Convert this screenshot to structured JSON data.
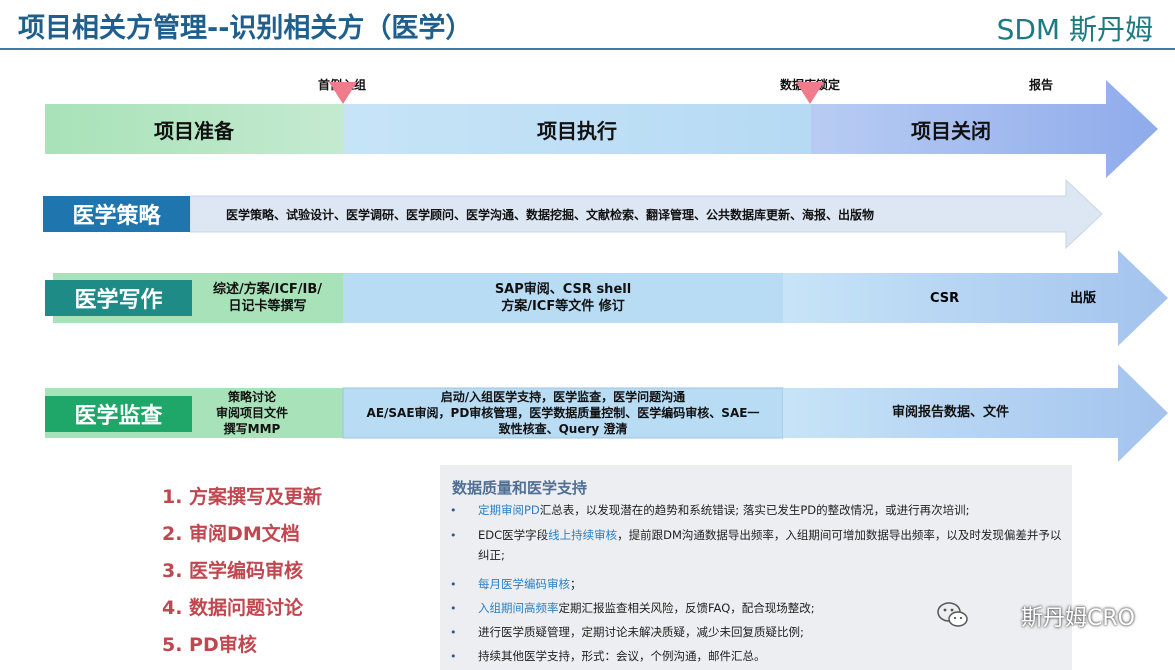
{
  "header": {
    "title": "项目相关方管理--识别相关方（医学）",
    "brand": "SDM 斯丹姆"
  },
  "milestones": {
    "first_enroll": "首例入组",
    "db_lock": "数据库锁定",
    "report": "报告"
  },
  "phases": {
    "prepare": "项目准备",
    "execute": "项目执行",
    "close": "项目关闭"
  },
  "strategy": {
    "label": "医学策略",
    "text": "医学策略、试验设计、医学调研、医学顾问、医学沟通、数据挖掘、文献检索、翻译管理、公共数据库更新、海报、出版物"
  },
  "writing": {
    "label": "医学写作",
    "prep_line1": "综述/方案/ICF/IB/",
    "prep_line2": "日记卡等撰写",
    "exec_line1": "SAP审阅、CSR shell",
    "exec_line2": "方案/ICF等文件 修订",
    "csr": "CSR",
    "publish": "出版"
  },
  "monitoring": {
    "label": "医学监查",
    "prep_line1": "策略讨论",
    "prep_line2": "审阅项目文件",
    "prep_line3": "撰写MMP",
    "exec_line1": "启动/入组医学支持，医学监查，医学问题沟通",
    "exec_line2": "AE/SAE审阅，PD审核管理，医学数据质量控制、医学编码审核、SAE一",
    "exec_line3": "致性核查、Query 澄清",
    "close_text": "审阅报告数据、文件"
  },
  "numbered_list": [
    "1. 方案撰写及更新",
    "2. 审阅DM文档",
    "3. 医学编码审核",
    "4. 数据问题讨论",
    "5. PD审核"
  ],
  "panel": {
    "title": "数据质量和医学支持",
    "b1_hl": "定期审阅PD",
    "b1_rest": "汇总表，以发现潜在的趋势和系统错误; 落实已发生PD的整改情况，或进行再次培训;",
    "b2_pre": "EDC医学字段",
    "b2_hl": "线上持续审核",
    "b2_rest": "，提前跟DM沟通数据导出频率，入组期间可增加数据导出频率，以及时发现偏差并予以纠正;",
    "b3_hl": "每月医学编码审核",
    "b3_rest": "；",
    "b4_hl": "入组期间高频率",
    "b4_rest": "定期汇报监查相关风险，反馈FAQ，配合现场整改;",
    "b5": "进行医学质疑管理，定期讨论未解决质疑，减少未回复质疑比例;",
    "b6": "持续其他医学支持，形式：会议，个例沟通，邮件汇总。"
  },
  "watermark": "斯丹姆CRO",
  "colors": {
    "green": "#a8e2b8",
    "light_blue": "#b9dcf5",
    "periwinkle": "#9fb6ee",
    "arrow_grey": "#dde7f3",
    "label_blue": "#1f75ad",
    "label_teal": "#1e8b87",
    "label_green": "#1fa669",
    "milestone_red": "#f07b8b",
    "list_red": "#c0474f"
  }
}
